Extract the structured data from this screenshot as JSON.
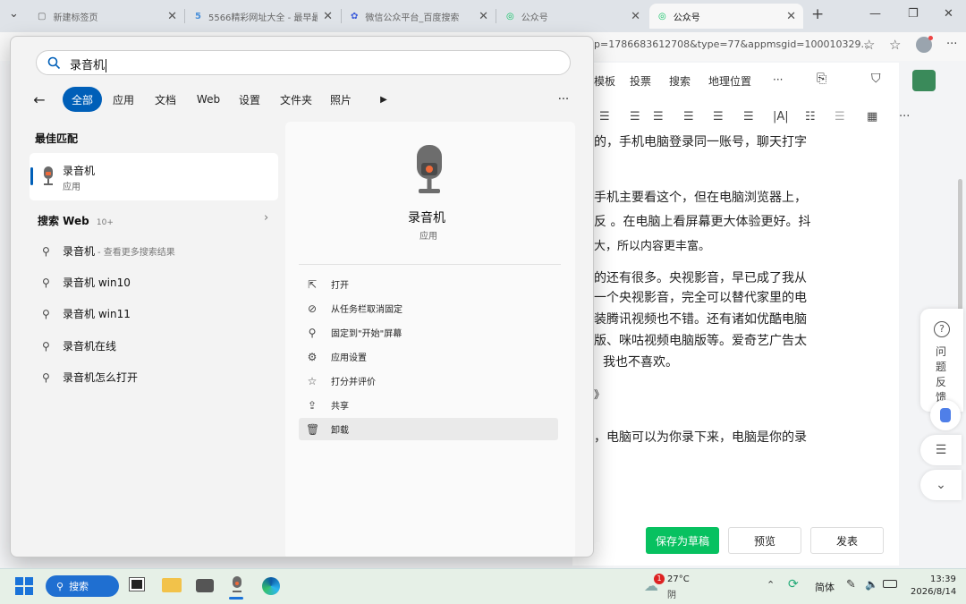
{
  "browser": {
    "tabs": [
      {
        "title": "新建标签页"
      },
      {
        "title": "5566精彩网址大全 - 最早最"
      },
      {
        "title": "微信公众平台_百度搜索"
      },
      {
        "title": "公众号"
      },
      {
        "title": "公众号"
      }
    ],
    "url": "p=1786683612708&type=77&appmsgid=100010329..."
  },
  "editor": {
    "toolbar1": [
      "模板",
      "投票",
      "搜索",
      "地理位置",
      "···"
    ],
    "paragraphs": [
      "的，手机电脑登录同一账号，聊天打字",
      "手机主要看这个，但在电脑浏览器上，",
      "反 。在电脑上看屏幕更大体验更好。抖",
      "大，所以内容更丰富。",
      "的还有很多。央视影音，早已成了我从",
      "一个央视影音，完全可以替代家里的电",
      "装腾讯视频也不错。还有诸如优酷电脑",
      "版、咪咕视频电脑版等。爱奇艺广告太",
      "我也不喜欢。",
      "》",
      "，电脑可以为你录下来，电脑是你的录"
    ],
    "feedback": {
      "label": "问题反馈"
    },
    "buttons": {
      "save": "保存为草稿",
      "preview": "预览",
      "publish": "发表"
    },
    "colors": {
      "save": "#07c160"
    }
  },
  "start_menu": {
    "search_value": "录音机",
    "filters": [
      "全部",
      "应用",
      "文档",
      "Web",
      "设置",
      "文件夹",
      "照片"
    ],
    "best_match_label": "最佳匹配",
    "best_match": {
      "name": "录音机",
      "type": "应用"
    },
    "web_section": {
      "label": "搜索 Web",
      "count": "10+"
    },
    "suggestions": [
      {
        "bold": "录音机",
        "rest": " - 查看更多搜索结果"
      },
      {
        "bold": "录音机 win10",
        "rest": ""
      },
      {
        "bold": "录音机 win11",
        "rest": ""
      },
      {
        "bold": "录音机在线",
        "rest": ""
      },
      {
        "bold": "录音机怎么打开",
        "rest": ""
      }
    ],
    "preview": {
      "name": "录音机",
      "type": "应用",
      "actions": [
        "打开",
        "从任务栏取消固定",
        "固定到\"开始\"屏幕",
        "应用设置",
        "打分并评价",
        "共享",
        "卸载"
      ]
    }
  },
  "taskbar": {
    "search_label": "搜索",
    "weather": {
      "temp": "27°C",
      "desc": "阴",
      "badge": "1"
    },
    "ime": "简体",
    "time": "13:39",
    "date": "2026/8/14"
  }
}
